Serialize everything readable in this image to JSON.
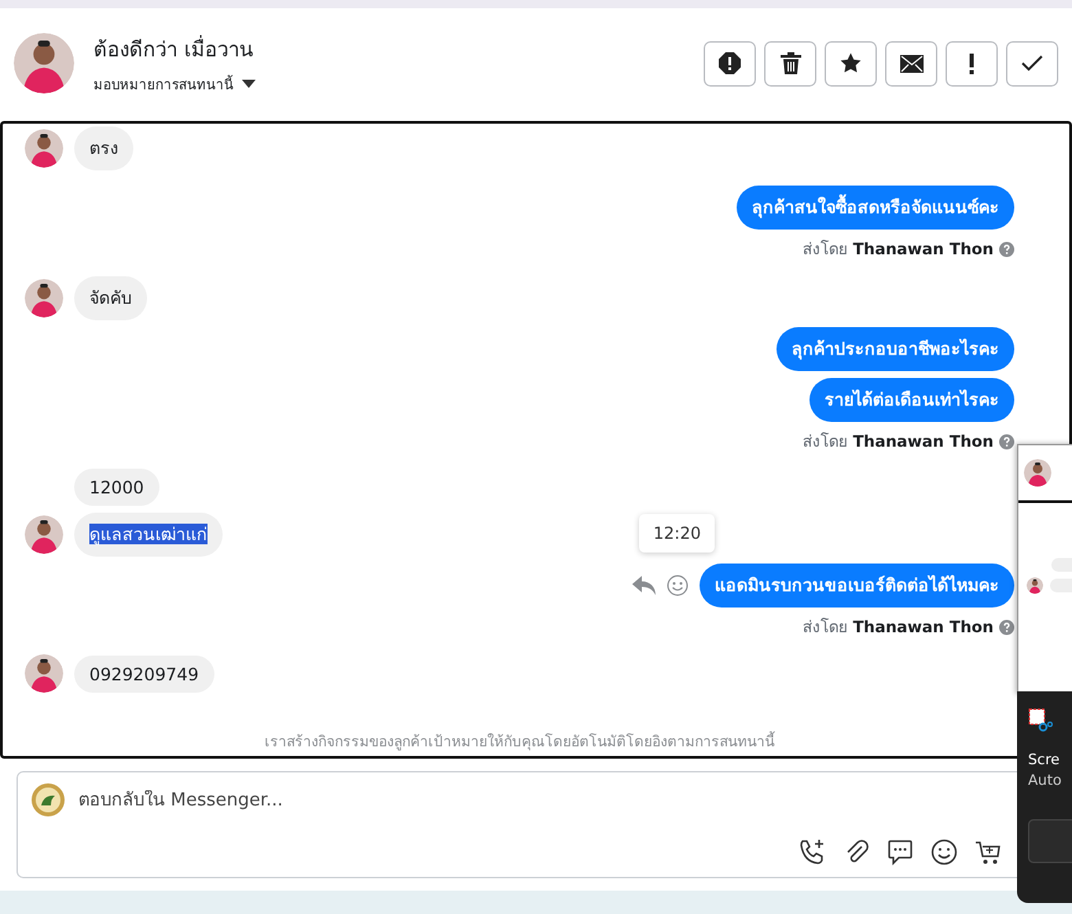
{
  "header": {
    "name": "ต้องดีกว่า เมื่อวาน",
    "assign": "มอบหมายการสนทนานี้",
    "actions": [
      {
        "kind": "spam"
      },
      {
        "kind": "trash"
      },
      {
        "kind": "star"
      },
      {
        "kind": "mail"
      },
      {
        "kind": "alert"
      },
      {
        "kind": "done"
      }
    ]
  },
  "messages": [
    {
      "kind": "in",
      "text": "ตรง",
      "avatar": true,
      "highlighted": false
    },
    {
      "kind": "out",
      "text": "ลุกค้าสนใจซื้อสดหรือจัดแนนซ์คะ",
      "hover_actions": false
    },
    {
      "kind": "sent_by",
      "prefix": "ส่งโดย",
      "name": "Thanawan Thon"
    },
    {
      "kind": "in",
      "text": "จัดคับ",
      "avatar": true,
      "highlighted": false
    },
    {
      "kind": "out",
      "text": "ลุกค้าประกอบอาชีพอะไรคะ",
      "hover_actions": false
    },
    {
      "kind": "out",
      "text": "รายได้ต่อเดือนเท่าไรคะ",
      "hover_actions": false
    },
    {
      "kind": "sent_by",
      "prefix": "ส่งโดย",
      "name": "Thanawan Thon"
    },
    {
      "kind": "in",
      "text": "12000",
      "avatar": false,
      "highlighted": false
    },
    {
      "kind": "in",
      "text": "ดูแลสวนเฒ่าแก่",
      "avatar": true,
      "highlighted": true
    },
    {
      "kind": "out",
      "text": "แอดมินรบกวนขอเบอร์ติดต่อได้ไหมคะ",
      "hover_actions": true,
      "tooltip": "12:20"
    },
    {
      "kind": "sent_by",
      "prefix": "ส่งโดย",
      "name": "Thanawan Thon"
    },
    {
      "kind": "in",
      "text": "0929209749",
      "avatar": true,
      "highlighted": false
    }
  ],
  "footer_note": "เราสร้างกิจกรรมของลูกค้าเป้าหมายให้กับคุณโดยอัตโนมัติโดยอิงตามการสนทนานี้",
  "composer": {
    "placeholder": "ตอบกลับใน Messenger...",
    "tools": [
      {
        "kind": "call"
      },
      {
        "kind": "attach"
      },
      {
        "kind": "comment"
      },
      {
        "kind": "emoji"
      },
      {
        "kind": "cart"
      }
    ]
  },
  "toast": {
    "title": "Scre",
    "subtitle": "Auto"
  }
}
